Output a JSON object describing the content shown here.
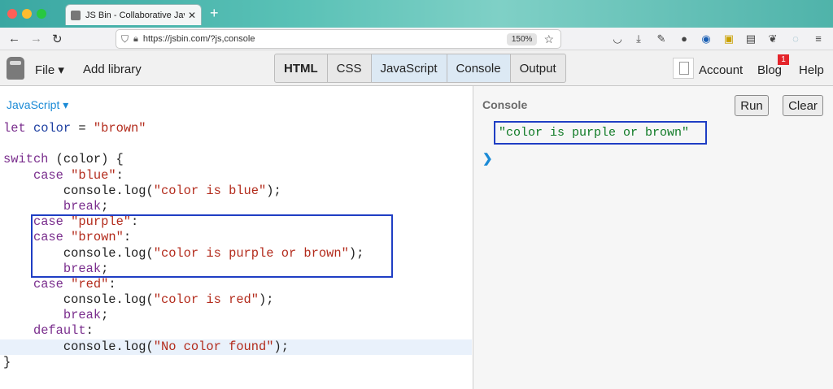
{
  "browser": {
    "tab_title": "JS Bin - Collaborative JavaScript",
    "tab_close": "✕",
    "new_tab": "+",
    "url": "https://jsbin.com/?js,console",
    "zoom": "150%"
  },
  "toolbar": {
    "file_label": "File ▾",
    "add_library_label": "Add library",
    "panels": [
      {
        "label": "HTML",
        "active": false
      },
      {
        "label": "CSS",
        "active": false
      },
      {
        "label": "JavaScript",
        "active": true
      },
      {
        "label": "Console",
        "active": true
      },
      {
        "label": "Output",
        "active": false
      }
    ],
    "account_label": "Account",
    "blog_label": "Blog",
    "blog_badge": "1",
    "help_label": "Help"
  },
  "editor": {
    "language": "JavaScript ▾",
    "code_lines": [
      "let color = \"brown\"",
      "",
      "switch (color) {",
      "    case \"blue\":",
      "        console.log(\"color is blue\");",
      "        break;",
      "    case \"purple\":",
      "    case \"brown\":",
      "        console.log(\"color is purple or brown\");",
      "        break;",
      "    case \"red\":",
      "        console.log(\"color is red\");",
      "        break;",
      "    default:",
      "        console.log(\"No color found\");",
      "}"
    ],
    "highlighted_line_index": 14
  },
  "console": {
    "title": "Console",
    "run_label": "Run",
    "clear_label": "Clear",
    "output": "\"color is purple or brown\"",
    "prompt": "❯"
  },
  "colors": {
    "keyword": "#7a2e8d",
    "string": "#b32b1c",
    "variable": "#1d3fa1",
    "annotation_box": "#1f3ec4",
    "console_output": "#0f7a25",
    "link_blue": "#1a8ad6"
  }
}
